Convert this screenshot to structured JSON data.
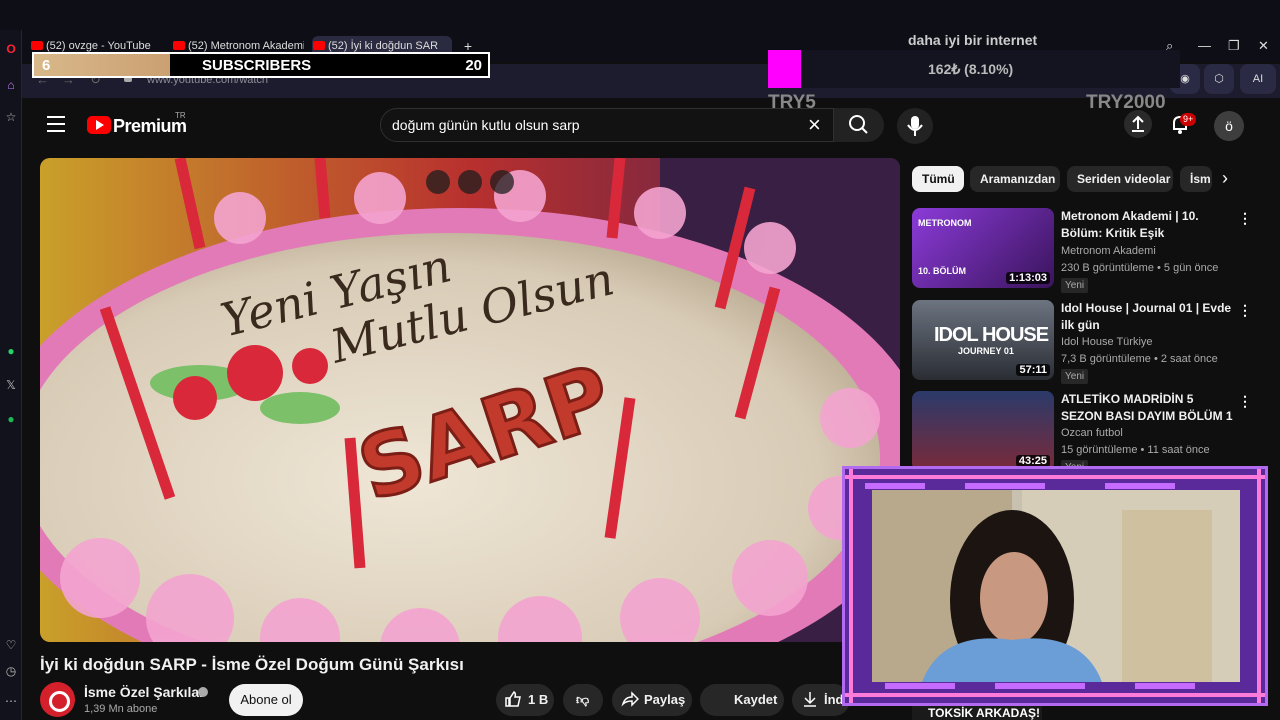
{
  "browser": {
    "tabs": [
      {
        "label": "(52) ovzge - YouTube"
      },
      {
        "label": "(52) Metronom Akademi |"
      },
      {
        "label": "(52) İyi ki doğdun SAR"
      }
    ],
    "new_tab": "+",
    "url": "www.youtube.com/watch",
    "ai_label": "AI"
  },
  "stream_overlay": {
    "subscriber_goal": {
      "current": "6",
      "label": "SUBSCRIBERS",
      "target": "20",
      "progress": 0.3
    },
    "donation": {
      "title": "daha iyi bir internet",
      "amount": "162₺ (8.10%)",
      "min": "TRY5",
      "max": "TRY2000",
      "progress": 0.081
    }
  },
  "header": {
    "brand": "Premium",
    "country": "TR",
    "search": {
      "value": "doğum günün kutlu olsun sarp"
    },
    "notifications": "9+",
    "avatar_initial": "ö"
  },
  "video": {
    "title": "İyi ki doğdun SARP - İsme Özel Doğum Günü Şarkısı",
    "cake_text": "Yeni Yaşın Mutlu Olsun",
    "cake_name": "SARP",
    "channel": {
      "name": "İsme Özel Şarkılar",
      "subs": "1,39 Mn abone"
    },
    "subscribe": "Abone ol",
    "likes": "1 B",
    "share": "Paylaş",
    "save": "Kaydet",
    "download": "İndi"
  },
  "chips": [
    {
      "label": "Tümü",
      "active": true
    },
    {
      "label": "Aramanızdan"
    },
    {
      "label": "Seriden videolar"
    },
    {
      "label": "İsm"
    }
  ],
  "recommendations": [
    {
      "title": "Metronom Akademi | 10. Bölüm: Kritik Eşik",
      "channel": "Metronom Akademi",
      "stats": "230 B görüntüleme • 5 gün önce",
      "badge": "Yeni",
      "duration": "1:13:03",
      "thumb_text": "10. BÖLÜM",
      "thumb_logo": "METRONOM"
    },
    {
      "title": "Idol House | Journal 01 | Evde ilk gün",
      "channel": "Idol House Türkiye",
      "stats": "7,3 B görüntüleme • 2 saat önce",
      "badge": "Yeni",
      "duration": "57:11",
      "thumb_text": "IDOL HOUSE",
      "thumb_sub": "JOURNEY 01"
    },
    {
      "title": "ATLETİKO MADRİDİN 5 SEZON BASI DAYIM BÖLÜM 1",
      "channel": "Ozcan futbol",
      "stats": "15 görüntüleme • 11 saat önce",
      "badge": "Yeni",
      "duration": "43:25"
    }
  ],
  "partial_rec": {
    "thumb_text": "TOKSİK ARKADAŞ!"
  },
  "colors": {
    "youtube_red": "#ff0000",
    "overlay_magenta": "#ff00ff",
    "cam_frame": "#b26bf0",
    "cake_pink": "#e27ab8"
  }
}
